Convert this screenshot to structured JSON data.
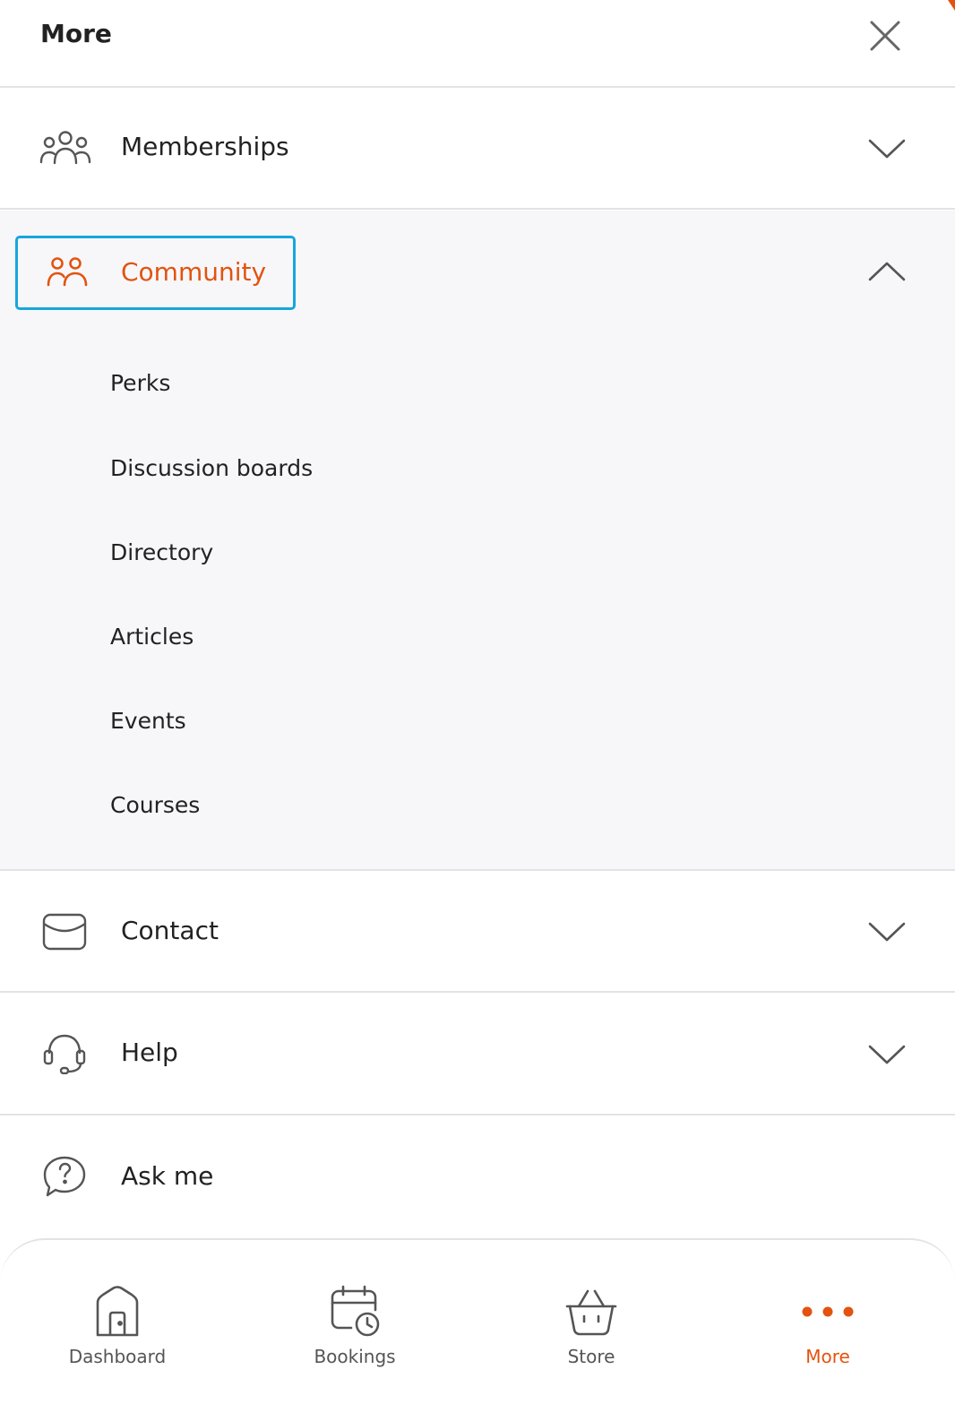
{
  "header": {
    "title": "More"
  },
  "icons": {
    "close": "close-icon",
    "memberships": "group-icon",
    "community": "people-icon",
    "contact": "envelope-icon",
    "help": "headset-icon",
    "ask_me": "chat-question-icon",
    "expand": "chevron-down-icon",
    "collapse": "chevron-up-icon"
  },
  "menu": {
    "memberships": {
      "label": "Memberships"
    },
    "community": {
      "label": "Community",
      "items": [
        {
          "label": "Perks"
        },
        {
          "label": "Discussion boards"
        },
        {
          "label": "Directory"
        },
        {
          "label": "Articles"
        },
        {
          "label": "Events"
        },
        {
          "label": "Courses"
        }
      ]
    },
    "contact": {
      "label": "Contact"
    },
    "help": {
      "label": "Help"
    },
    "ask_me": {
      "label": "Ask me"
    }
  },
  "bottom_nav": {
    "items": [
      {
        "label": "Dashboard",
        "icon": "home-icon"
      },
      {
        "label": "Bookings",
        "icon": "calendar-clock-icon"
      },
      {
        "label": "Store",
        "icon": "basket-icon"
      },
      {
        "label": "More",
        "icon": "more-dots-icon"
      }
    ],
    "active": "More"
  },
  "colors": {
    "accent": "#e3530f",
    "focus_ring": "#17a6dc",
    "text": "#222222",
    "muted_text": "#555555",
    "divider": "#e3e3e6",
    "expanded_background": "#f7f7fa"
  }
}
